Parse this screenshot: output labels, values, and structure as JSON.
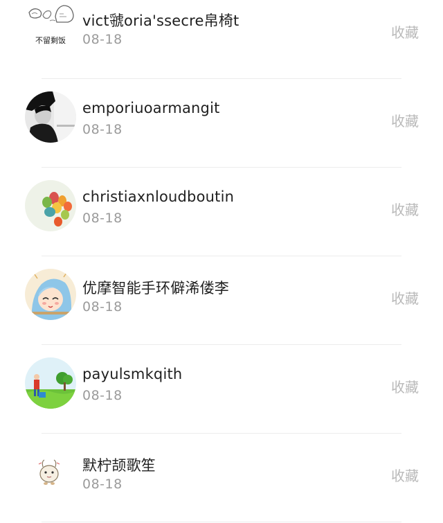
{
  "items": [
    {
      "name": "vict虢oria'ssecre帛椅t",
      "date": "08-18",
      "action": "收藏",
      "avatar": "sketch-text-avatar",
      "avatar_caption": "不留剩饭"
    },
    {
      "name": "emporiuoarmangit",
      "date": "08-18",
      "action": "收藏",
      "avatar": "person-bw-avatar"
    },
    {
      "name": "christiaxnloudboutin",
      "date": "08-18",
      "action": "收藏",
      "avatar": "colorful-eggs-avatar"
    },
    {
      "name": "优摩智能手环僻浠偻李",
      "date": "08-18",
      "action": "收藏",
      "avatar": "anime-girl-avatar"
    },
    {
      "name": "payulsmkqith",
      "date": "08-18",
      "action": "收藏",
      "avatar": "landscape-avatar"
    },
    {
      "name": "默柠颉歌笙",
      "date": "08-18",
      "action": "收藏",
      "avatar": "cute-creature-avatar"
    }
  ]
}
